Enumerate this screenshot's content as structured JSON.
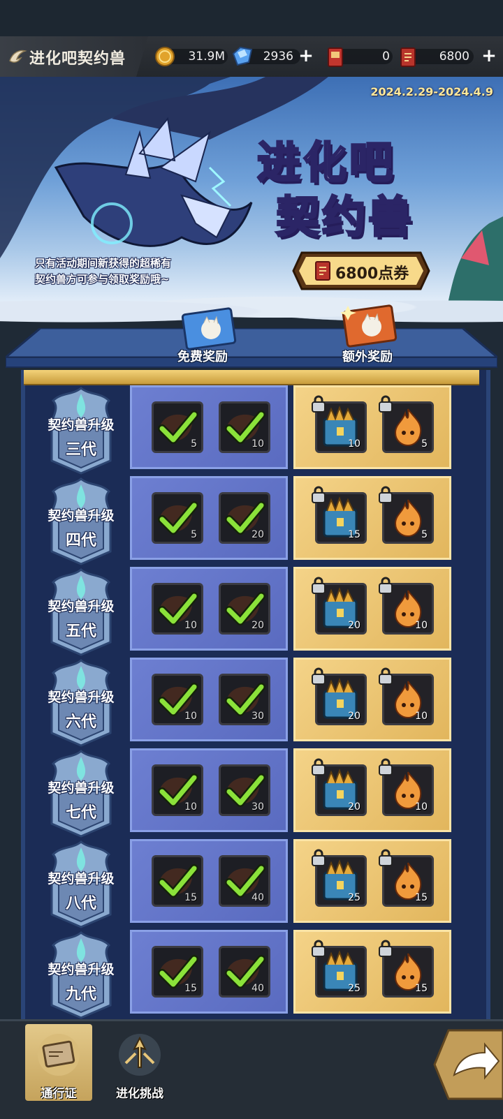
{
  "header": {
    "title": "进化吧契约兽",
    "resources": [
      {
        "icon": "gold-coin-icon",
        "value": "31.9M"
      },
      {
        "icon": "diamond-icon",
        "value": "2936",
        "plus": true
      },
      {
        "icon": "event-ticket-icon",
        "value": "0"
      },
      {
        "icon": "point-voucher-icon",
        "value": "6800",
        "plus": true
      }
    ]
  },
  "banner": {
    "date_range": "2024.2.29-2024.4.9",
    "title_line1": "进化吧",
    "title_line2": "契约兽",
    "description_line1": "只有活动期间新获得的超稀有",
    "description_line2": "契约兽方可参与领取奖励哦~",
    "price": "6800点券"
  },
  "columns": {
    "free": "免费奖励",
    "extra": "额外奖励"
  },
  "rows": [
    {
      "title": "契约兽升级",
      "level": "三代",
      "free": [
        "5",
        "10"
      ],
      "extra": [
        "10",
        "5"
      ]
    },
    {
      "title": "契约兽升级",
      "level": "四代",
      "free": [
        "5",
        "20"
      ],
      "extra": [
        "15",
        "5"
      ]
    },
    {
      "title": "契约兽升级",
      "level": "五代",
      "free": [
        "10",
        "20"
      ],
      "extra": [
        "20",
        "10"
      ]
    },
    {
      "title": "契约兽升级",
      "level": "六代",
      "free": [
        "10",
        "30"
      ],
      "extra": [
        "20",
        "10"
      ]
    },
    {
      "title": "契约兽升级",
      "level": "七代",
      "free": [
        "10",
        "30"
      ],
      "extra": [
        "20",
        "10"
      ]
    },
    {
      "title": "契约兽升级",
      "level": "八代",
      "free": [
        "15",
        "40"
      ],
      "extra": [
        "25",
        "15"
      ]
    },
    {
      "title": "契约兽升级",
      "level": "九代",
      "free": [
        "15",
        "40"
      ],
      "extra": [
        "25",
        "15"
      ]
    }
  ],
  "nav": {
    "pass": "通行证",
    "challenge": "进化挑战"
  },
  "colors": {
    "free_cell": "#6d7fd1",
    "extra_cell": "#f4d388",
    "check": "#8be23a"
  }
}
